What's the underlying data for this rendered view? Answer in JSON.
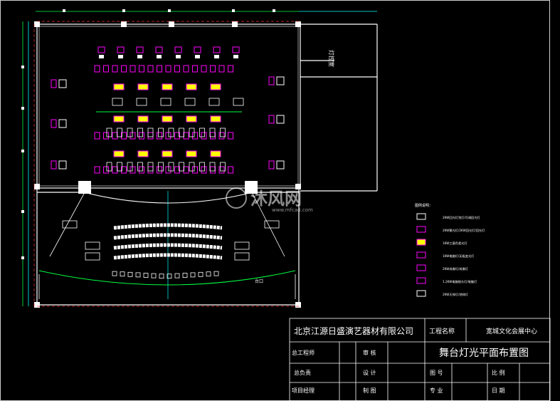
{
  "watermark": {
    "text": "沐风网",
    "url": "www.mfcad.com"
  },
  "plan": {
    "room_label": "灯控室",
    "stage_apron_label": "台口"
  },
  "title_block": {
    "company": "北京江源日盛演艺器材有限公司",
    "project_name_label": "工程名称",
    "project_name": "宽城文化会展中心",
    "drawing_title": "舞台灯光平面布置图",
    "chief_engineer_label": "总工程师",
    "review_label": "审  核",
    "general_manager_label": "总负责",
    "design_label": "设  计",
    "drawing_no_label": "图  号",
    "scale_label": "比  例",
    "project_manager_label": "项目经理",
    "drafting_label": "制  图",
    "discipline_label": "专  业",
    "date_label": "日  期"
  },
  "legend": {
    "title": "图例说明：",
    "items": [
      "2KW回光灯泡灯/可调回光灯",
      "2KW聚光灯/2KW回光灯/回光灯",
      "1KW三基色柔光灯",
      "1KW电脑灯/无极变光灯",
      "2KW成像灯/成像灯",
      "1.2KW电脑摇头灯/电脑灯",
      "2KW天排灯/地排灯"
    ]
  },
  "colors": {
    "line": "#ffffff",
    "magenta": "#ff00ff",
    "yellow": "#ffff00",
    "green": "#00ff40",
    "cyan": "#00ffff",
    "red": "#ff3030"
  }
}
